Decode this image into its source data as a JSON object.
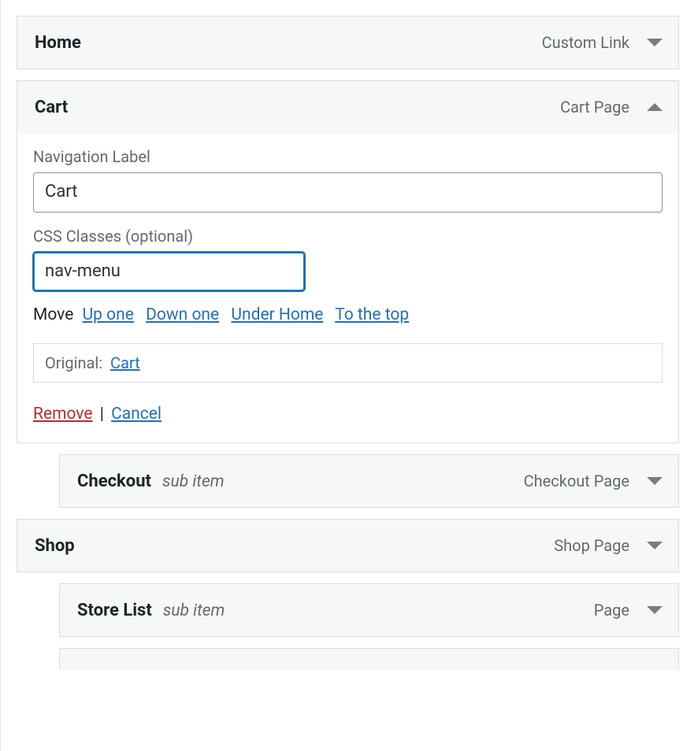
{
  "items": [
    {
      "title": "Home",
      "type": "Custom Link",
      "sub": "",
      "expanded": false,
      "depth": 0
    },
    {
      "title": "Cart",
      "type": "Cart Page",
      "sub": "",
      "expanded": true,
      "depth": 0,
      "fields": {
        "nav_label_label": "Navigation Label",
        "nav_label_value": "Cart",
        "css_label": "CSS Classes (optional)",
        "css_value": "nav-menu"
      },
      "move": {
        "label": "Move",
        "links": [
          "Up one",
          "Down one",
          "Under Home",
          "To the top"
        ]
      },
      "original": {
        "label": "Original:",
        "link": "Cart"
      },
      "actions": {
        "remove": "Remove",
        "cancel": "Cancel"
      }
    },
    {
      "title": "Checkout",
      "type": "Checkout Page",
      "sub": "sub item",
      "expanded": false,
      "depth": 1
    },
    {
      "title": "Shop",
      "type": "Shop Page",
      "sub": "",
      "expanded": false,
      "depth": 0
    },
    {
      "title": "Store List",
      "type": "Page",
      "sub": "sub item",
      "expanded": false,
      "depth": 1
    }
  ]
}
